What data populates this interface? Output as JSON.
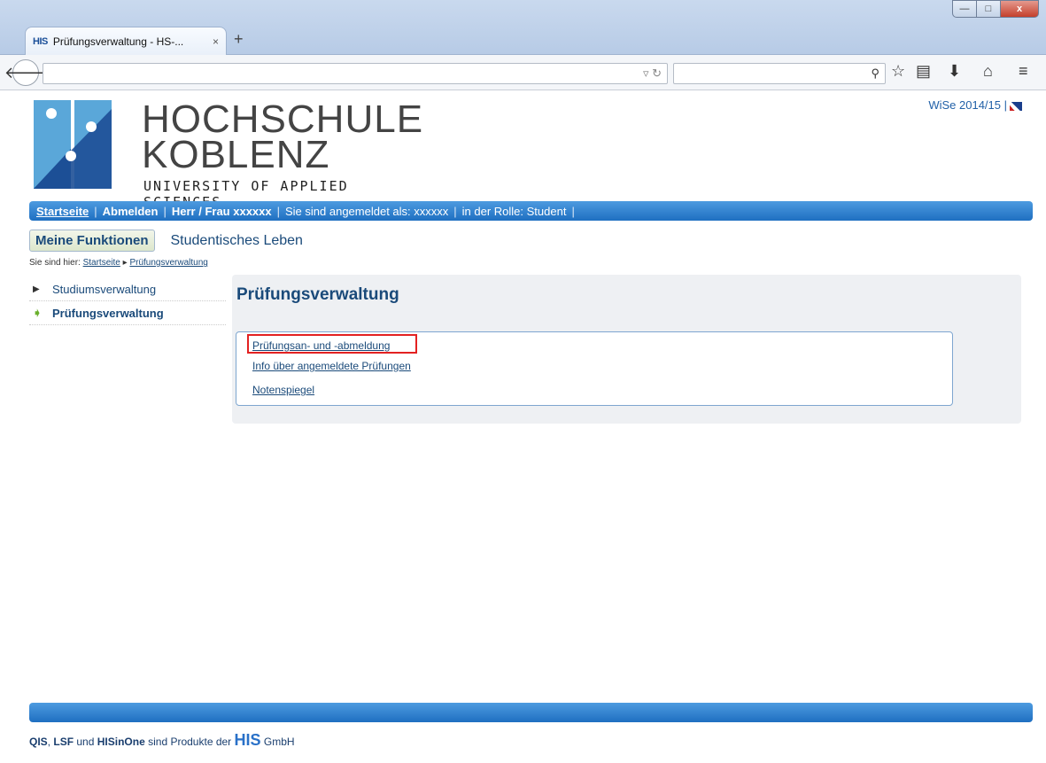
{
  "browser": {
    "tab_favicon": "HIS",
    "tab_title": "Prüfungsverwaltung - HS-...",
    "tab_close": "×",
    "new_tab": "+",
    "win_min": "—",
    "win_max": "□",
    "win_close": "x"
  },
  "header": {
    "logo_line1": "HOCHSCHULE",
    "logo_line2": "KOBLENZ",
    "logo_line3": "UNIVERSITY OF APPLIED SCIENCES",
    "semester": "WiSe 2014/15 |"
  },
  "userbar": {
    "startseite": "Startseite",
    "abmelden": "Abmelden",
    "herr_frau": "Herr / Frau xxxxxx",
    "angemeldet": "Sie sind angemeldet als:  xxxxxx",
    "rolle": "in der Rolle: Student"
  },
  "functions": {
    "meine": "Meine Funktionen",
    "studentisch": "Studentisches Leben"
  },
  "breadcrumb": {
    "prefix": "Sie sind hier:",
    "start": "Startseite",
    "current": "Prüfungsverwaltung"
  },
  "sidebar": {
    "items": [
      {
        "label": "Studiumsverwaltung"
      },
      {
        "label": "Prüfungsverwaltung"
      }
    ]
  },
  "content": {
    "title": "Prüfungsverwaltung",
    "links": [
      "Prüfungsan- und -abmeldung",
      "Info über angemeldete Prüfungen",
      "Notenspiegel"
    ]
  },
  "footer": {
    "qis": "QIS",
    "sep1": ",",
    "lsf": "LSF",
    "und": "und",
    "hisinone": "HISinOne",
    "text": "sind Produkte der",
    "his": "HIS",
    "gmbh": "GmbH"
  },
  "colors": {
    "accent": "#1f6fc1",
    "highlight": "#e32121"
  }
}
